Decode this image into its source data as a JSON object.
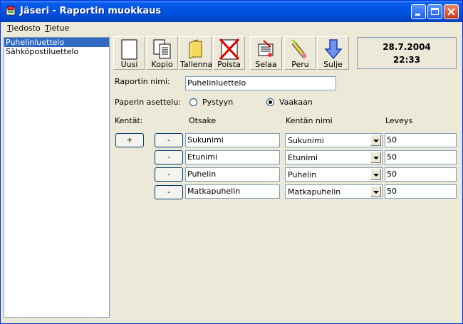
{
  "window": {
    "title": "Jäseri - Raportin muokkaus"
  },
  "menu": {
    "items": [
      {
        "mnemonic": "T",
        "rest": "iedosto"
      },
      {
        "mnemonic": "T",
        "rest": "ietue"
      }
    ]
  },
  "report_list": {
    "items": [
      {
        "label": "Puhelinluettelo",
        "selected": true
      },
      {
        "label": "Sähköpostiluettelo",
        "selected": false
      }
    ]
  },
  "toolbar": {
    "buttons": [
      {
        "label": "Uusi",
        "icon": "new-document-icon"
      },
      {
        "label": "Kopio",
        "icon": "copy-icon"
      },
      {
        "label": "Tallenna",
        "icon": "save-folder-icon"
      },
      {
        "label": "Poista",
        "icon": "delete-x-icon"
      },
      {
        "label": "Selaa",
        "icon": "browse-icon"
      },
      {
        "label": "Peru",
        "icon": "eraser-icon"
      },
      {
        "label": "Sulje",
        "icon": "close-arrow-icon"
      }
    ]
  },
  "datetime": {
    "date": "28.7.2004",
    "time": "22:33"
  },
  "form": {
    "report_name_label": "Raportin nimi:",
    "report_name_value": "Puhelinluettelo",
    "paper_layout_label": "Paperin asettelu:",
    "orientation_portrait": "Pystyyn",
    "orientation_landscape": "Vaakaan",
    "selected_orientation": "Vaakaan",
    "fields_label": "Kentät:",
    "col_heading": "Otsake",
    "col_field_name": "Kentän nimi",
    "col_width": "Leveys",
    "add_button": "+",
    "remove_button": "-",
    "rows": [
      {
        "heading": "Sukunimi",
        "field": "Sukunimi",
        "width": "50"
      },
      {
        "heading": "Etunimi",
        "field": "Etunimi",
        "width": "50"
      },
      {
        "heading": "Puhelin",
        "field": "Puhelin",
        "width": "50"
      },
      {
        "heading": "Matkapuhelin",
        "field": "Matkapuhelin",
        "width": "50"
      }
    ]
  }
}
